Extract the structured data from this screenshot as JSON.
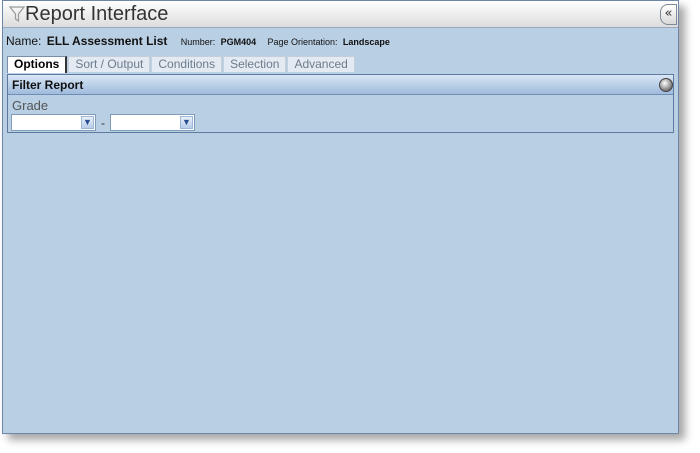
{
  "window": {
    "title": "Report Interface",
    "collapse_glyph": "«"
  },
  "report": {
    "name_label": "Name:",
    "name_value": "ELL Assessment List",
    "number_label": "Number:",
    "number_value": "PGM404",
    "orientation_label": "Page Orientation:",
    "orientation_value": "Landscape"
  },
  "tabs": [
    {
      "label": "Options",
      "active": true
    },
    {
      "label": "Sort / Output",
      "active": false
    },
    {
      "label": "Conditions",
      "active": false
    },
    {
      "label": "Selection",
      "active": false
    },
    {
      "label": "Advanced",
      "active": false
    }
  ],
  "filter_panel": {
    "title": "Filter Report",
    "grade_label": "Grade",
    "grade_from": "",
    "grade_to": "",
    "separator": "-"
  },
  "icons": {
    "title": "filter-funnel-icon",
    "panel": "circle-toggle-icon",
    "select_arrow": "chevron-down-icon"
  },
  "colors": {
    "background": "#b9cfe4",
    "panel_header": "#9fbbdc",
    "border": "#5e7aa0"
  }
}
